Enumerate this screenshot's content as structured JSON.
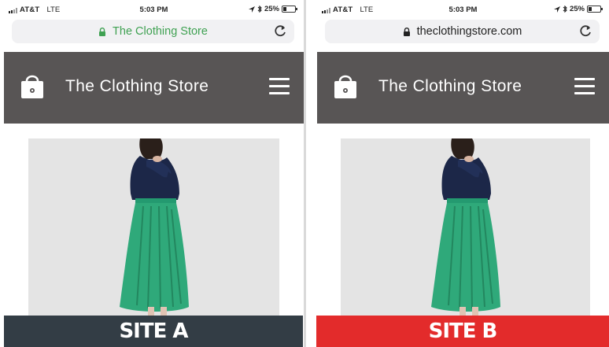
{
  "phone_a": {
    "status": {
      "carrier": "AT&T",
      "network": "LTE",
      "time": "5:03 PM",
      "battery": "25%",
      "battery_level": 0.25
    },
    "url": {
      "text": "The Clothing Store",
      "secure_indicator": "lock-icon",
      "color": "#3fa152"
    },
    "header": {
      "title": "The Clothing Store",
      "bg_color": "#585555"
    }
  },
  "phone_b": {
    "status": {
      "carrier": "AT&T",
      "network": "LTE",
      "time": "5:03 PM",
      "battery": "25%",
      "battery_level": 0.25
    },
    "url": {
      "text": "theclothingstore.com",
      "secure_indicator": "lock-icon",
      "color": "#222222"
    },
    "header": {
      "title": "The Clothing Store",
      "bg_color": "#585555"
    }
  },
  "labels": {
    "a": {
      "text": "SITE A",
      "color": "#333d45"
    },
    "b": {
      "text": "SITE B",
      "color": "#e32b2b"
    }
  }
}
